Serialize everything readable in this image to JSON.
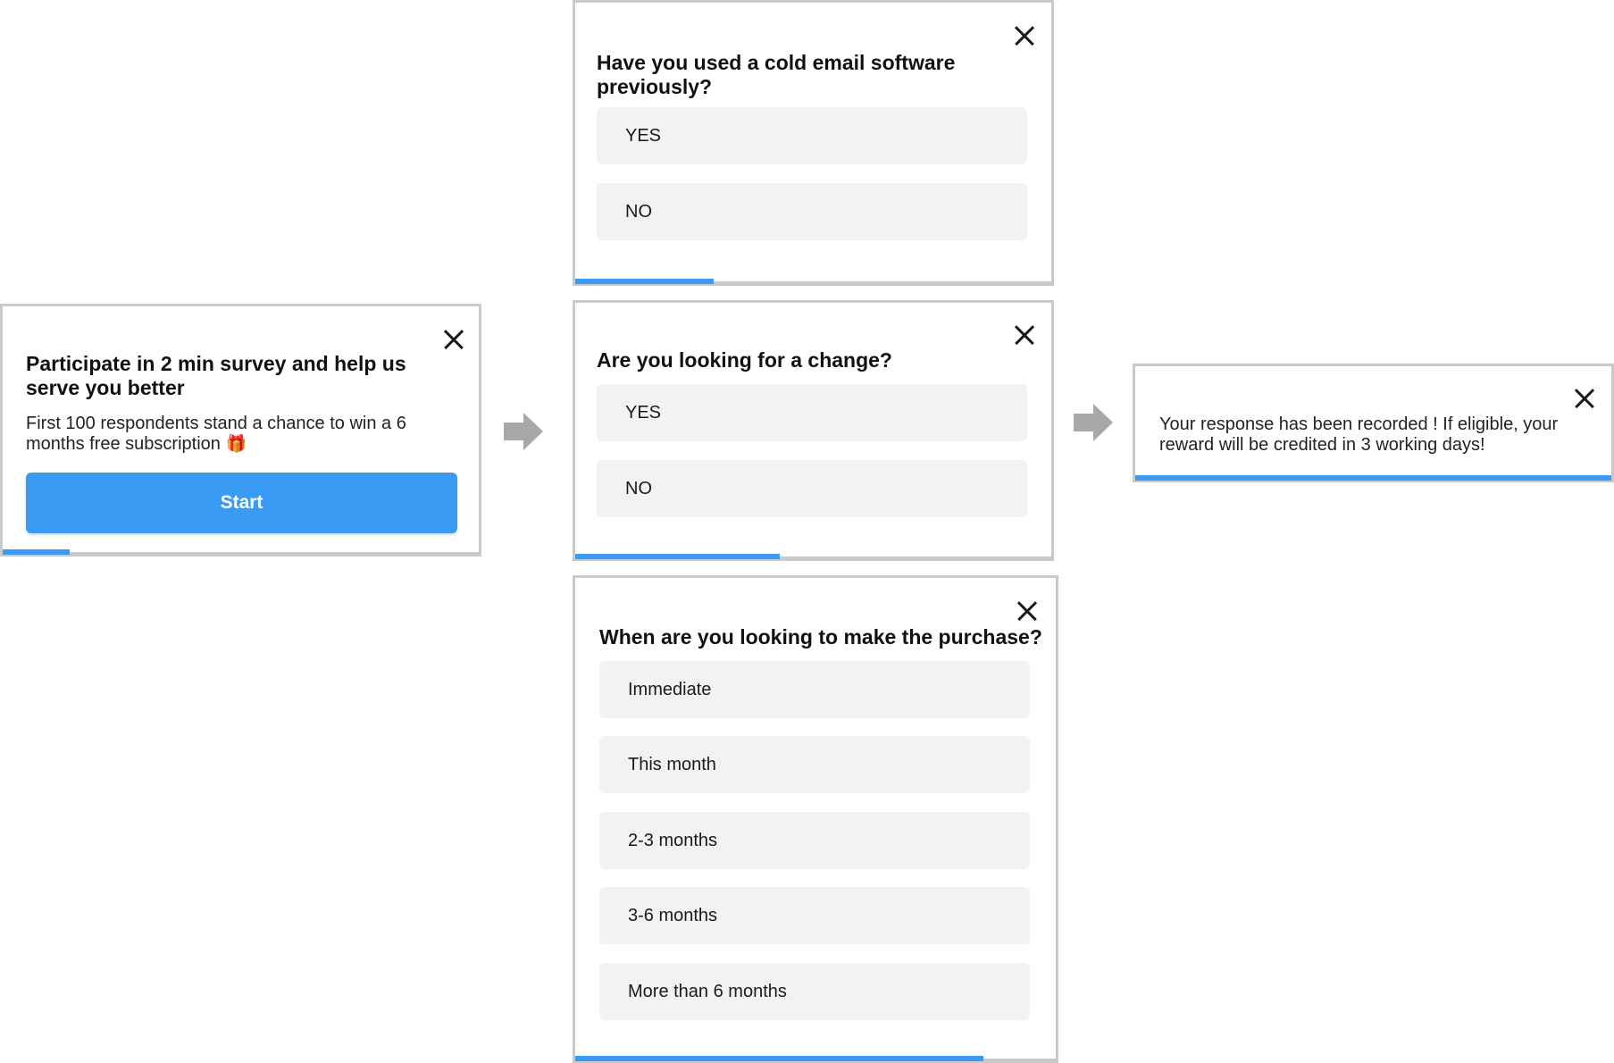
{
  "colors": {
    "accent": "#3a9bf5",
    "option_bg": "#f2f2f2",
    "arrow": "#a8a8a8"
  },
  "intro": {
    "title": "Participate in 2 min survey and help us serve you better",
    "body": "First 100 respondents stand a chance to win a 6 months free subscription",
    "gift_icon": "🎁",
    "start_label": "Start",
    "progress": 0.14
  },
  "questions": [
    {
      "text": "Have you used a cold email software previously?",
      "options": [
        "YES",
        "NO"
      ],
      "progress": 0.29
    },
    {
      "text": "Are you looking for a change?",
      "options": [
        "YES",
        "NO"
      ],
      "progress": 0.43
    },
    {
      "text": "When are you looking to make the purchase?",
      "options": [
        "Immediate",
        "This month",
        "2-3 months",
        "3-6 months",
        "More than 6 months"
      ],
      "progress": 0.85
    }
  ],
  "thanks": {
    "message": "Your response has been recorded ! If eligible, your reward will be credited in 3 working days!",
    "progress": 1.0
  },
  "icons": {
    "close": "close-icon",
    "flow_arrow": "arrow-right-icon",
    "gift": "gift-icon"
  }
}
